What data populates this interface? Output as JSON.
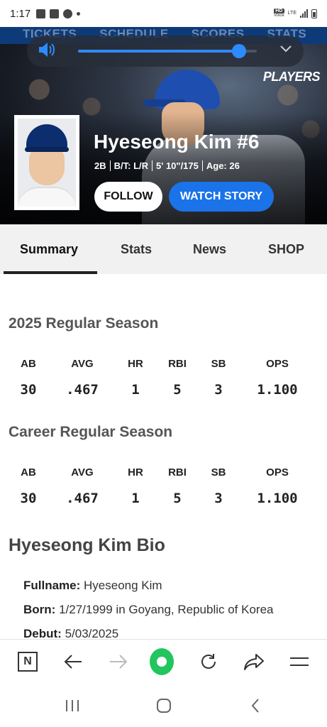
{
  "status_bar": {
    "time": "1:17",
    "hd_label": "HD",
    "voice_label": "Voice",
    "lte_label": "LTE"
  },
  "top_nav": [
    "TICKETS",
    "SCHEDULE",
    "SCORES",
    "STATS"
  ],
  "volume": {
    "level": 0.9,
    "accent": "#2d8bff"
  },
  "brand_logo": "PLAYERS",
  "player": {
    "name": "Hyeseong Kim #6",
    "meta": [
      "2B",
      "B/T: L/R",
      "5' 10\"/175",
      "Age: 26"
    ],
    "follow_label": "FOLLOW",
    "watch_label": "WATCH STORY"
  },
  "tabs": [
    {
      "label": "Summary",
      "active": true
    },
    {
      "label": "Stats"
    },
    {
      "label": "News"
    },
    {
      "label": "SHOP"
    }
  ],
  "season": {
    "title": "2025 Regular Season",
    "headers": [
      "AB",
      "AVG",
      "HR",
      "RBI",
      "SB",
      "OPS"
    ],
    "values": [
      "30",
      ".467",
      "1",
      "5",
      "3",
      "1.100"
    ]
  },
  "career": {
    "title": "Career Regular Season",
    "headers": [
      "AB",
      "AVG",
      "HR",
      "RBI",
      "SB",
      "OPS"
    ],
    "values": [
      "30",
      ".467",
      "1",
      "5",
      "3",
      "1.100"
    ]
  },
  "bio": {
    "title": "Hyeseong Kim Bio",
    "rows": [
      {
        "label": "Fullname:",
        "value": "Hyeseong Kim"
      },
      {
        "label": "Born:",
        "value": "1/27/1999 in Goyang, Republic of Korea"
      },
      {
        "label": "Debut:",
        "value": "5/03/2025"
      }
    ]
  },
  "colors": {
    "accent_blue": "#1a73e8",
    "home_green": "#22c55e",
    "nav_blue": "#0d3b7a"
  },
  "browser_icons": [
    "n-tab-icon",
    "back-icon",
    "forward-icon",
    "home-icon",
    "reload-icon",
    "share-icon",
    "menu-icon"
  ],
  "system_nav_icons": [
    "recents-icon",
    "home-icon",
    "back-icon"
  ]
}
